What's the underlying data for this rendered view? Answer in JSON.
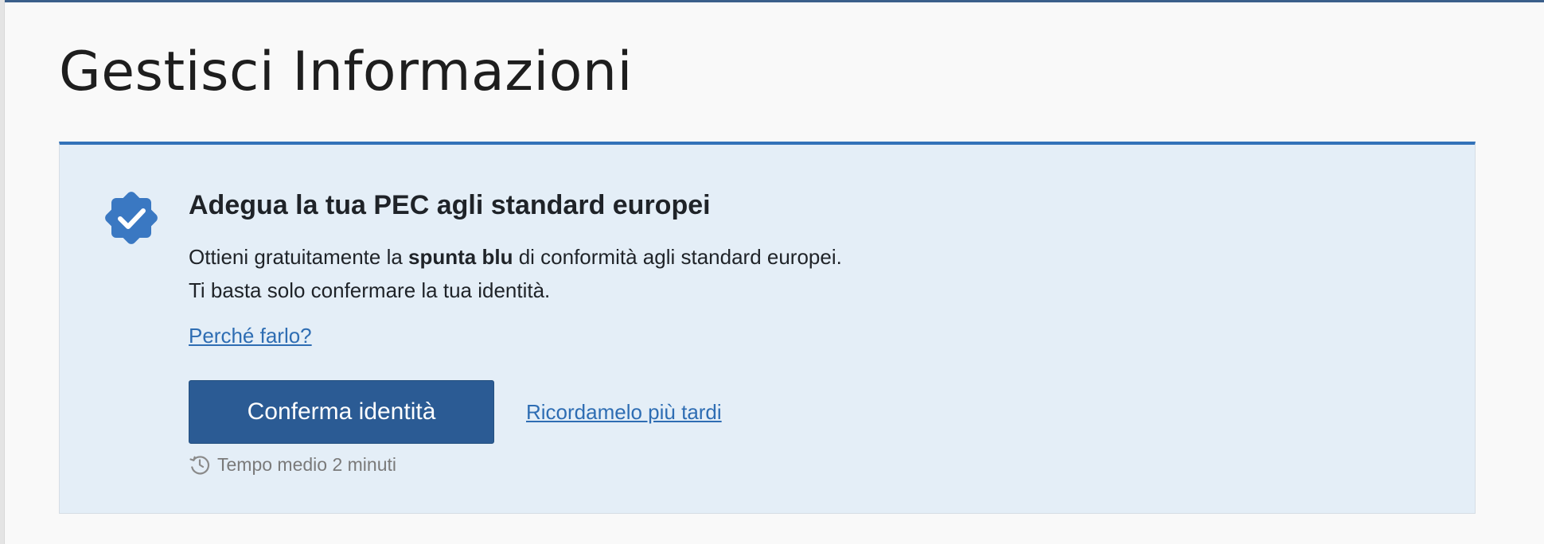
{
  "page": {
    "title": "Gestisci Informazioni"
  },
  "notice": {
    "icon": "verified-badge-icon",
    "title": "Adegua la tua PEC agli standard europei",
    "body_line1_prefix": "Ottieni gratuitamente la ",
    "body_line1_bold": "spunta blu",
    "body_line1_suffix": " di conformità agli standard europei.",
    "body_line2": "Ti basta solo confermare la tua identità.",
    "why_link": "Perché farlo?",
    "confirm_button": "Conferma identità",
    "later_link": "Ricordamelo più tardi",
    "time_icon": "clock-history-icon",
    "time_hint": "Tempo medio 2 minuti"
  },
  "colors": {
    "accent": "#3372b9",
    "button": "#2b5b94",
    "notice_background": "#e4eef7",
    "link": "#2e6db3",
    "page_background": "#f9f9f9"
  }
}
